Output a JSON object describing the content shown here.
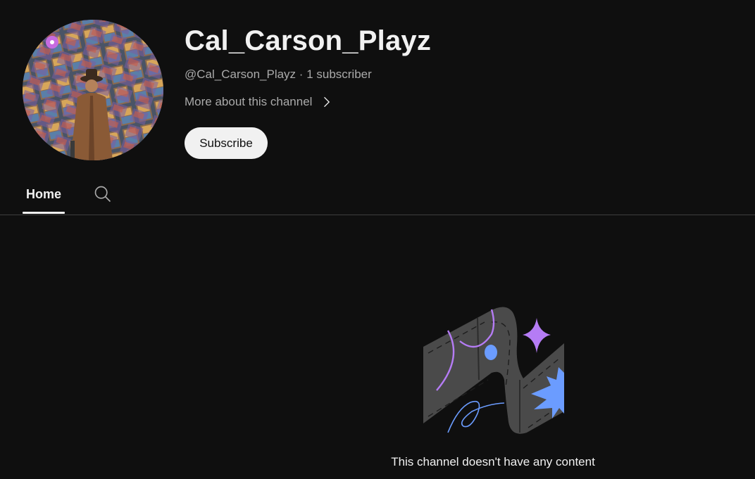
{
  "channel": {
    "name": "Cal_Carson_Playz",
    "handle": "@Cal_Carson_Playz",
    "separator": "·",
    "subscribers": "1 subscriber",
    "more_about": "More about this channel",
    "subscribe_label": "Subscribe"
  },
  "tabs": [
    {
      "label": "Home",
      "active": true
    }
  ],
  "empty_state": {
    "message": "This channel doesn't have any content"
  },
  "colors": {
    "background": "#0f0f0f",
    "text_primary": "#f1f1f1",
    "text_secondary": "#aaaaaa",
    "divider": "#3f3f3f",
    "accent_purple": "#b57cf5",
    "accent_blue": "#6b9cff"
  },
  "icons": {
    "more_chevron": "chevron-right-icon",
    "search": "search-icon"
  }
}
